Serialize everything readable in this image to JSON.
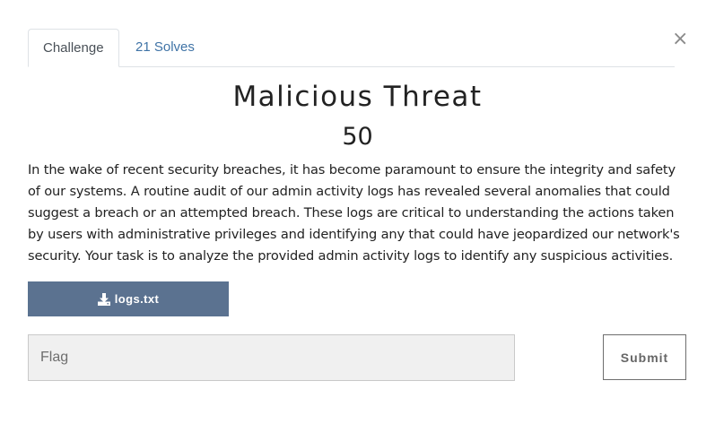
{
  "modal": {
    "close_icon": "close-icon",
    "close_glyph": "×"
  },
  "tabs": [
    {
      "label": "Challenge",
      "active": true
    },
    {
      "label": "21 Solves",
      "active": false
    }
  ],
  "challenge": {
    "name": "Malicious Threat",
    "value": "50",
    "description": "In the wake of recent security breaches, it has become paramount to ensure the integrity and safety of our systems. A routine audit of our admin activity logs has revealed several anomalies that could suggest a breach or an attempted breach. These logs are critical to understanding the actions taken by users with administrative privileges and identifying any that could have jeopardized our network's security. Your task is to analyze the provided admin activity logs to identify any suspicious activities.",
    "file": {
      "label": "logs.txt",
      "icon": "download-icon"
    }
  },
  "form": {
    "flag_placeholder": "Flag",
    "flag_value": "",
    "submit_label": "Submit"
  },
  "colors": {
    "file_button": "#5b7290",
    "tab_link": "#3f73a6",
    "input_background": "#f0f0f0"
  }
}
